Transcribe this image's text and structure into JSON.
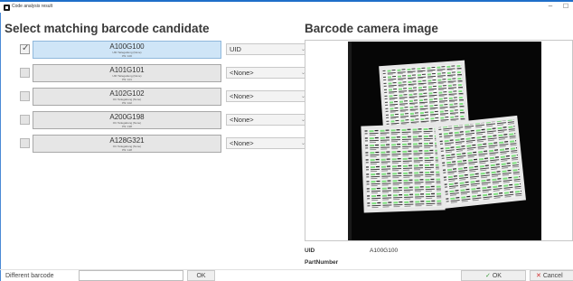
{
  "window": {
    "title": "Code analysis result"
  },
  "left": {
    "heading": "Select matching barcode candidate",
    "candidates": [
      {
        "code": "A100G100",
        "detail": "UID Teilegattung (None)",
        "sub": "PN: 100",
        "checked": true,
        "selected": true,
        "field": "UID"
      },
      {
        "code": "A101G101",
        "detail": "UID Teilegattung (None)",
        "sub": "PN: 101",
        "checked": false,
        "selected": false,
        "field": "<None>"
      },
      {
        "code": "A102G102",
        "detail": "OC Teilegattung (None)",
        "sub": "PN: 102",
        "checked": false,
        "selected": false,
        "field": "<None>"
      },
      {
        "code": "A200G198",
        "detail": "OC Teilegattung (None)",
        "sub": "PN: 198",
        "checked": false,
        "selected": false,
        "field": "<None>"
      },
      {
        "code": "A128G321",
        "detail": "OC Teilegattung (None)",
        "sub": "PN: 128",
        "checked": false,
        "selected": false,
        "field": "<None>"
      }
    ]
  },
  "right": {
    "heading": "Barcode camera image",
    "uid_label": "UID",
    "uid_value": "A100G100",
    "partnumber_label": "PartNumber"
  },
  "bottom": {
    "different_barcode_label": "Different barcode",
    "different_barcode_value": "",
    "ok_small": "OK",
    "ok": "OK",
    "cancel": "Cancel"
  },
  "colors": {
    "accent": "#1f6fc9",
    "selected_candidate": "#cfe5f7",
    "label_green": "#7de07d",
    "ok_green": "#3a9a3a",
    "cancel_red": "#d03030"
  }
}
